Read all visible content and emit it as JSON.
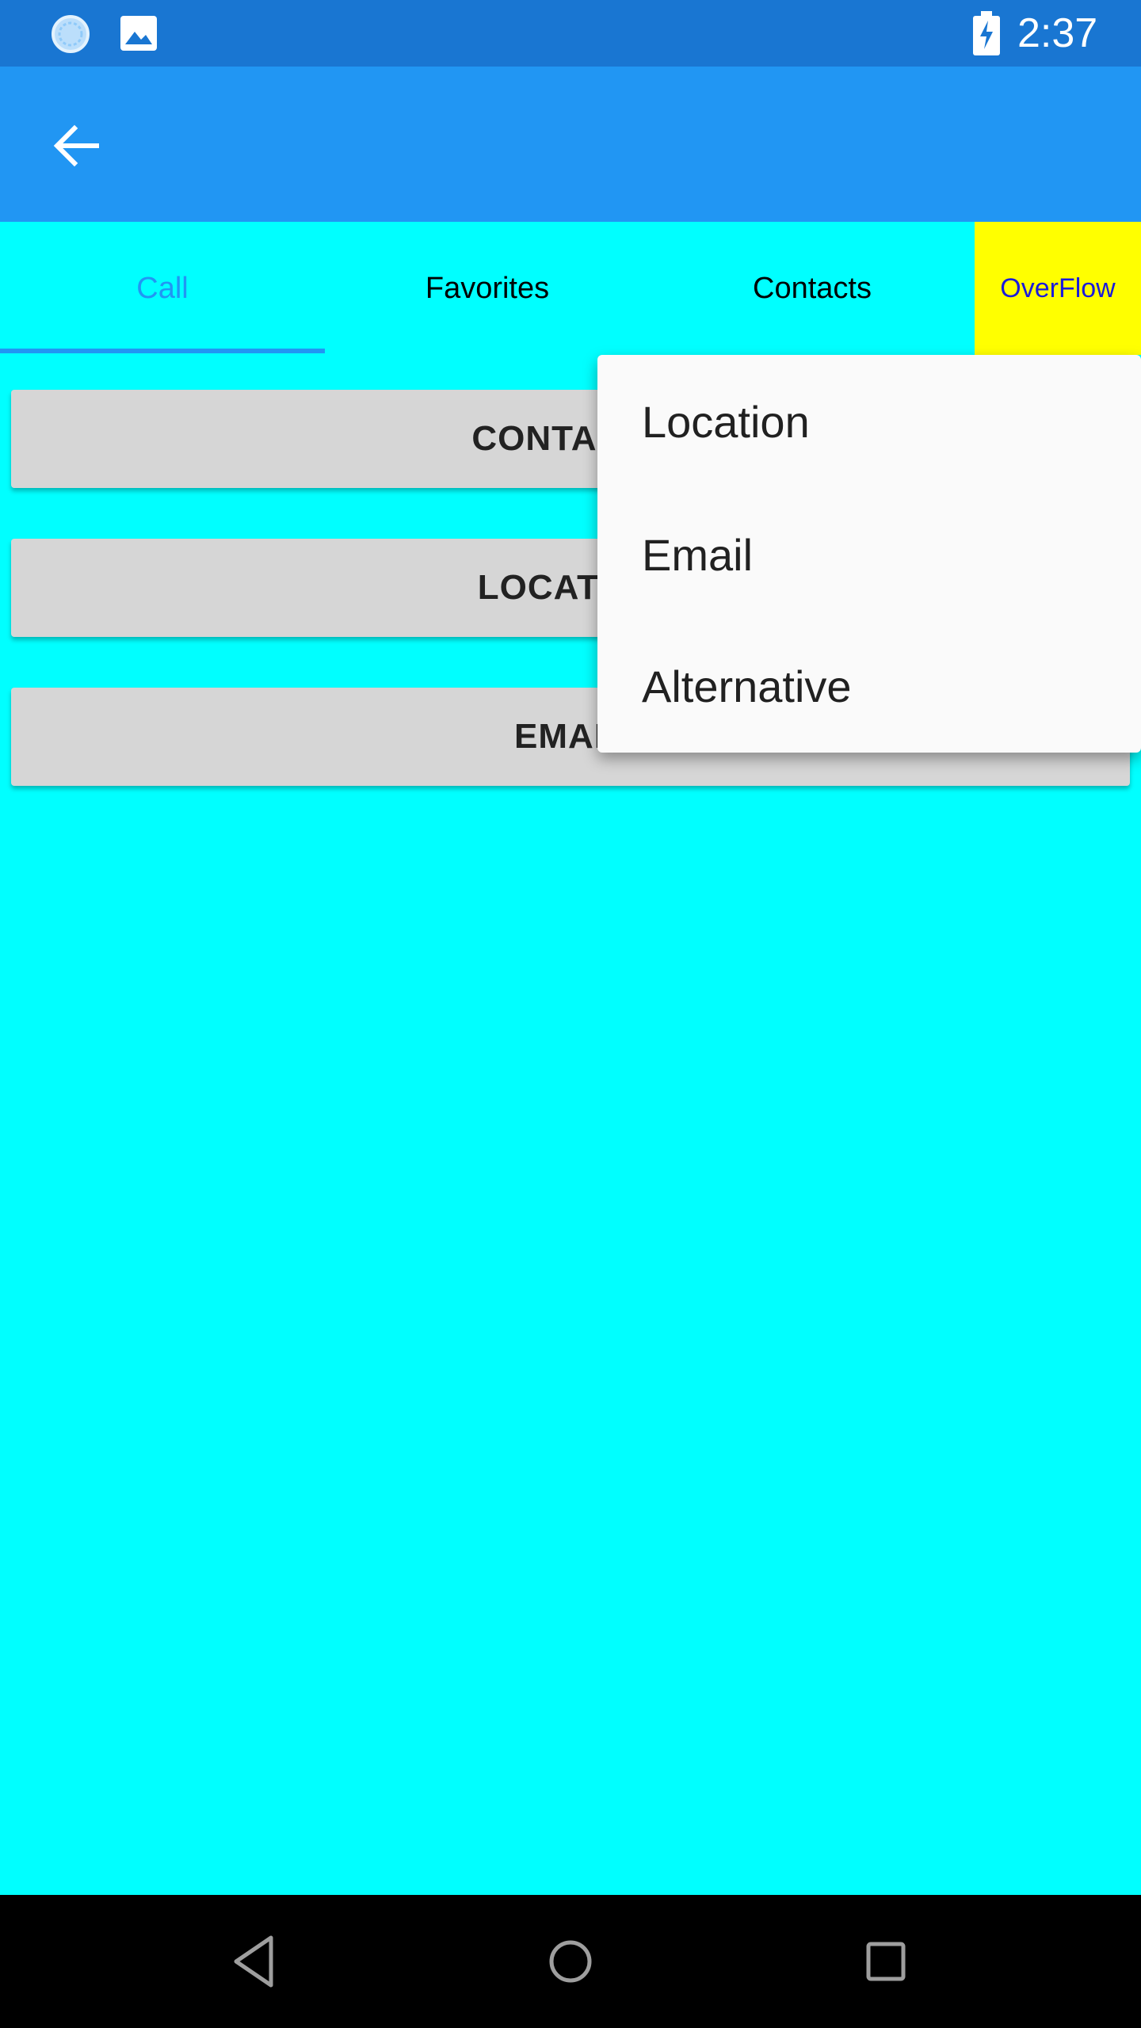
{
  "status_bar": {
    "time": "2:37",
    "icons": [
      "sync-icon",
      "image-notification-icon",
      "battery-charging-icon"
    ]
  },
  "app_bar": {
    "back_icon": "arrow-left-icon"
  },
  "tabs": [
    {
      "label": "Call",
      "selected": true
    },
    {
      "label": "Favorites",
      "selected": false
    },
    {
      "label": "Contacts",
      "selected": false
    },
    {
      "label": "OverFlow",
      "selected": false
    }
  ],
  "buttons": {
    "contacts": "CONTACTS",
    "location": "LOCATION",
    "email": "EMAIL"
  },
  "overflow_menu": {
    "items": [
      "Location",
      "Email",
      "Alternative"
    ]
  },
  "nav_bar": {
    "icons": [
      "back-triangle-icon",
      "home-circle-icon",
      "recents-square-icon"
    ]
  },
  "colors": {
    "status_bar": "#1976d2",
    "app_bar": "#2196f3",
    "content_background": "#00ffff",
    "overflow_tab": "#ffff00",
    "selected_tab": "#2196f3",
    "button": "#d6d6d6"
  }
}
